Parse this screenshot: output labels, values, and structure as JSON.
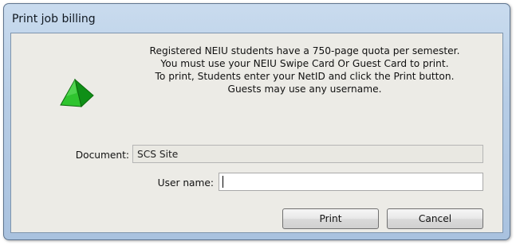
{
  "window": {
    "title": "Print job billing"
  },
  "message": {
    "lines": [
      "Registered NEIU students have a 750-page quota per semester.",
      "You must use your NEIU Swipe Card Or Guest Card to print.",
      "To print, Students enter your NetID and click the Print button.",
      "Guests may use any username."
    ],
    "icon": "green-pyramid-icon"
  },
  "document": {
    "label": "Document:",
    "value": "SCS Site"
  },
  "user": {
    "label": "User name:",
    "value": ""
  },
  "buttons": {
    "print": "Print",
    "cancel": "Cancel"
  },
  "colors": {
    "title_bar": "#b7cde6",
    "client_bg": "#ecebe6",
    "icon_green": "#22b022"
  }
}
